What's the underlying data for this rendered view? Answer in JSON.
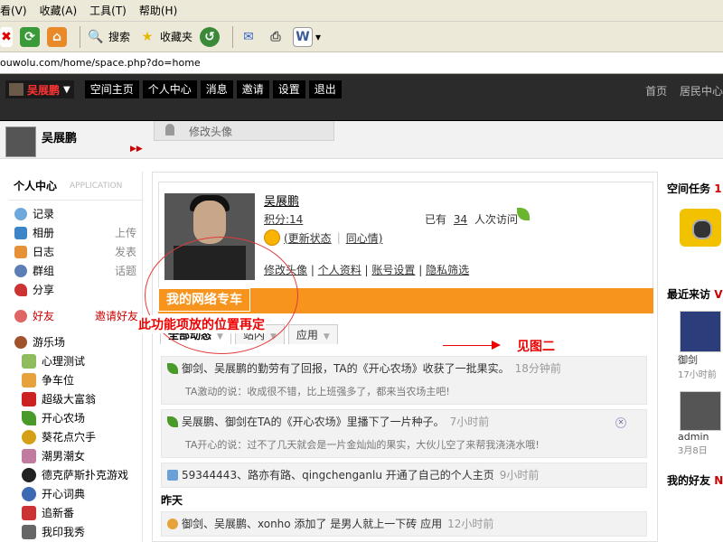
{
  "browser": {
    "menu": [
      "看(V)",
      "收藏(A)",
      "工具(T)",
      "帮助(H)"
    ],
    "toolbar": {
      "search": "搜索",
      "favorites": "收藏夹"
    },
    "address": "ouwolu.com/home/space.php?do=home"
  },
  "topnav": {
    "username": "吴展鹏",
    "items": [
      "空间主页",
      "个人中心",
      "消息",
      "邀请",
      "设置",
      "退出"
    ],
    "right": [
      "首页",
      "居民中心"
    ]
  },
  "userbar": {
    "name": "吴展鹏",
    "tab": "修改头像"
  },
  "left": {
    "header": "个人中心",
    "app": "APPLICATION",
    "items": [
      {
        "label": "记录",
        "right": ""
      },
      {
        "label": "相册",
        "right": "上传"
      },
      {
        "label": "日志",
        "right": "发表"
      },
      {
        "label": "群组",
        "right": "话题"
      },
      {
        "label": "分享",
        "right": ""
      }
    ],
    "friends": {
      "label": "好友",
      "right": "邀请好友"
    },
    "apps_header": "游乐场",
    "apps": [
      "心理测试",
      "争车位",
      "超级大富翁",
      "开心农场",
      "葵花点穴手",
      "潮男潮女",
      "德克萨斯扑克游戏",
      "开心词典",
      "追新番",
      "我印我秀"
    ]
  },
  "profile": {
    "name": "吴展鹏",
    "score": "积分:14",
    "status_link": "(更新状态",
    "mood_link": "同心情)",
    "visits_prefix": "已有",
    "visits": "34",
    "visits_suffix": "人次访问",
    "links": [
      "修改头像",
      "个人资料",
      "账号设置",
      "隐私筛选"
    ]
  },
  "orange_label": "我的网络专车",
  "annotation": "此功能项放的位置再定",
  "arrow_note": "见图二",
  "tabs": [
    "全部动态",
    "站内",
    "应用"
  ],
  "feed": [
    {
      "main": "御剑、吴展鹏的勤劳有了回报，TA的《开心农场》收获了一批果实。",
      "time": "18分钟前",
      "sub": "TA激动的说：收成很不错，比上班强多了，都来当农场主吧!"
    },
    {
      "main": "吴展鹏、御剑在TA的《开心农场》里播下了一片种子。",
      "time": "7小时前",
      "sub": "TA开心的说：过不了几天就会是一片金灿灿的果实，大伙儿空了来帮我浇浇水哦!"
    },
    {
      "main": "59344443、路亦有路、qingchenganlu 开通了自己的个人主页",
      "time": "9小时前",
      "sub": ""
    }
  ],
  "yesterday": "昨天",
  "feed_cut": "御剑、吴展鹏、xonho 添加了 是男人就上一下砖 应用",
  "feed_cut_time": "12小时前",
  "right": {
    "task_title": "空间任务",
    "task_red": "1",
    "visitors_title": "最近来访",
    "visitors_red": "V",
    "visitor1": "御剑",
    "visitor1_time": "17小时前",
    "visitor2": "admin",
    "visitor2_time": "3月8日",
    "friends_title": "我的好友",
    "friends_red": "N"
  }
}
